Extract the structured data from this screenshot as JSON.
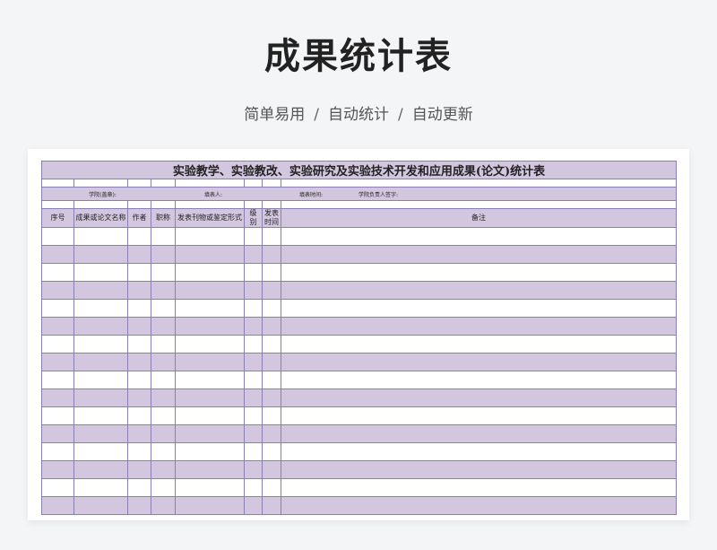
{
  "page": {
    "title": "成果统计表",
    "tags": [
      "简单易用",
      "自动统计",
      "自动更新"
    ],
    "separator": "/"
  },
  "sheet": {
    "banner": "实验教学、实验教改、实验研究及实验技术开发和应用成果(论文)统计表",
    "info": {
      "college": "学院(盖章):",
      "filler": "填表人:",
      "fill_time": "填表时间:",
      "leader": "学院负责人签字:"
    },
    "columns": [
      "序号",
      "成果或论文名称",
      "作者",
      "职称",
      "发表刊物或鉴定形式",
      "级别",
      "发表时间",
      "备注"
    ],
    "data_row_count": 16,
    "colors": {
      "row_purple": "#d2c7df",
      "grid_line": "#8a80b0",
      "background": "#f4f5f7"
    }
  }
}
